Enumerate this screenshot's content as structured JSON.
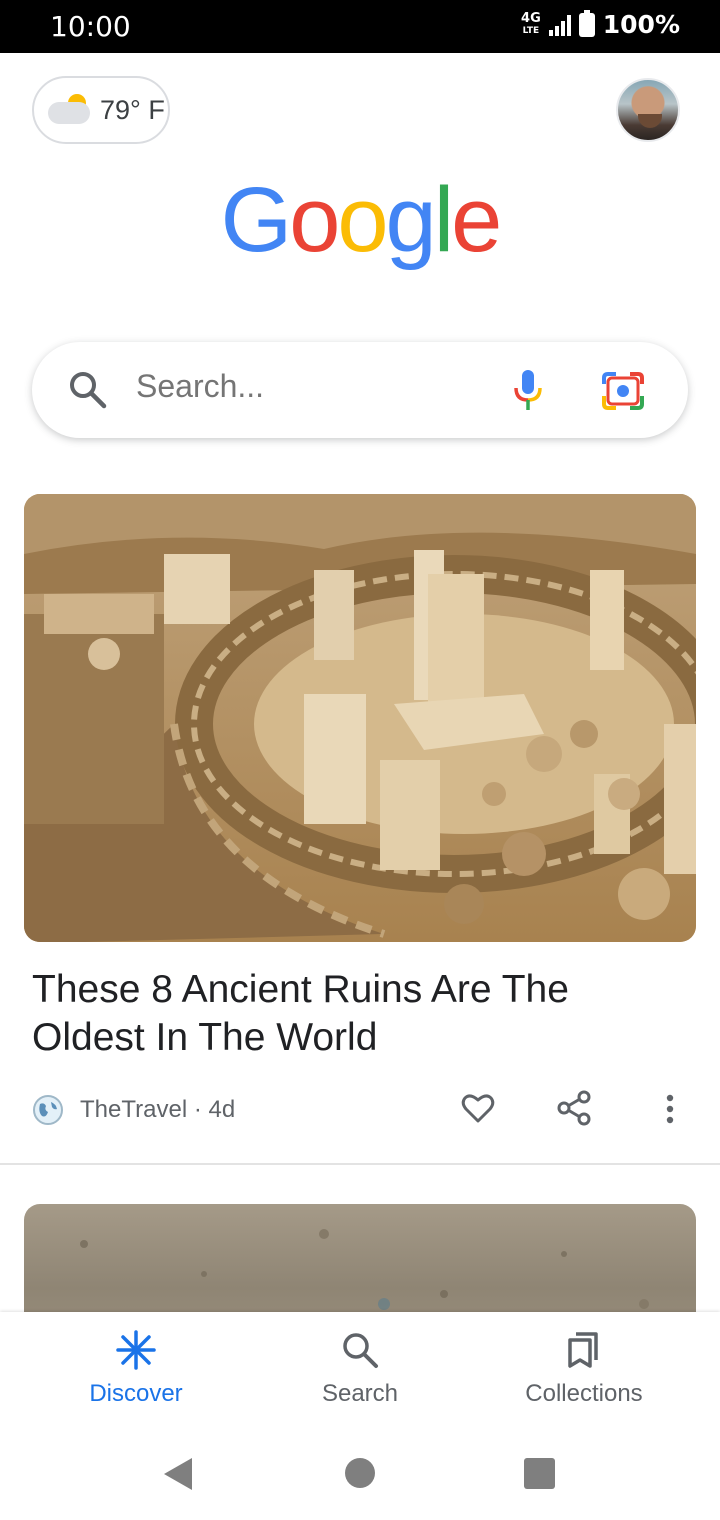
{
  "status_bar": {
    "time": "10:00",
    "network": "4G",
    "network_sub": "LTE",
    "battery": "100%"
  },
  "weather": {
    "temperature": "79° F",
    "icon": "partly-cloudy-icon"
  },
  "logo": {
    "letters": [
      "G",
      "o",
      "o",
      "g",
      "l",
      "e"
    ],
    "colors": [
      "#4285F4",
      "#EA4335",
      "#FBBC05",
      "#4285F4",
      "#34A853",
      "#EA4335"
    ]
  },
  "search": {
    "placeholder": "Search..."
  },
  "article": {
    "title": "These 8 Ancient Ruins Are The Oldest In The World",
    "source": "TheTravel · 4d"
  },
  "bottom_nav": {
    "items": [
      {
        "label": "Discover",
        "icon": "discover-icon",
        "active": true
      },
      {
        "label": "Search",
        "icon": "search-icon",
        "active": false
      },
      {
        "label": "Collections",
        "icon": "collections-icon",
        "active": false
      }
    ]
  },
  "colors": {
    "accent": "#1a73e8",
    "text_secondary": "#5f6368"
  }
}
